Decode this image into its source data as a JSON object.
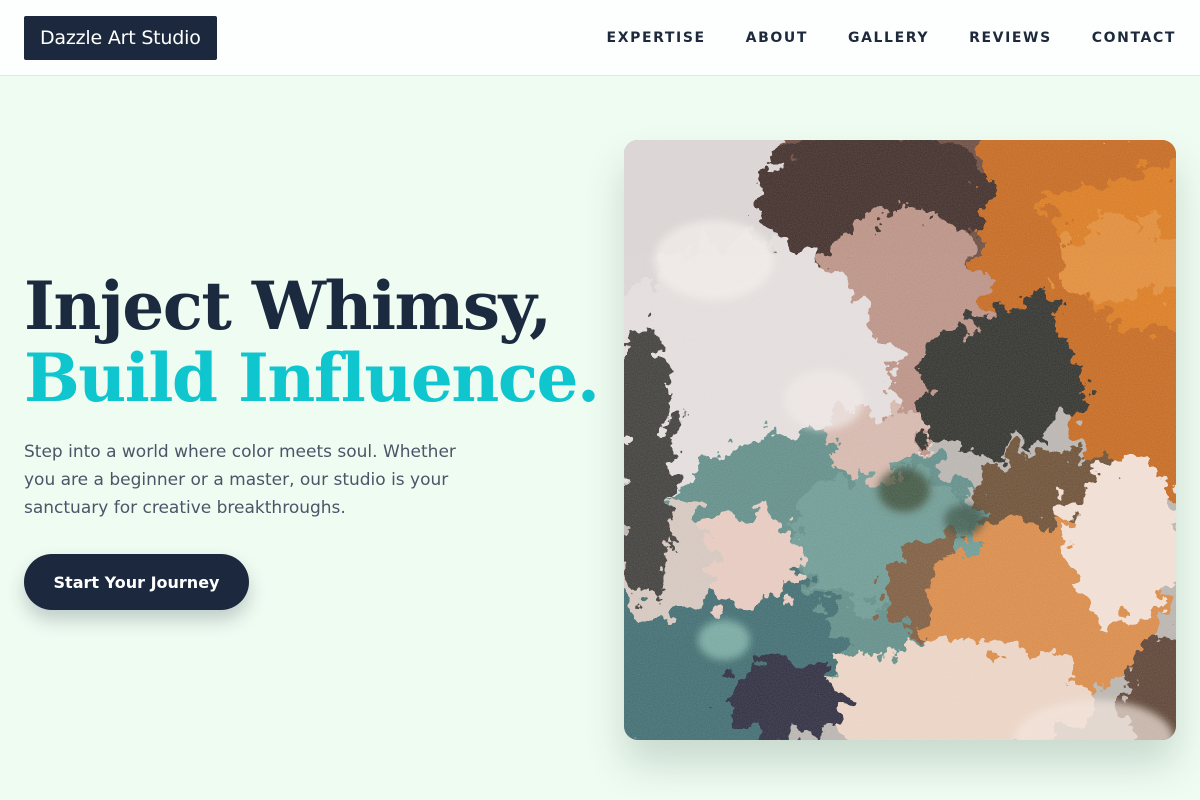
{
  "header": {
    "logo": "Dazzle Art Studio",
    "nav": [
      "EXPERTISE",
      "ABOUT",
      "GALLERY",
      "REVIEWS",
      "CONTACT"
    ]
  },
  "hero": {
    "title_line1": "Inject Whimsy,",
    "title_line2": "Build Influence.",
    "subtitle": "Step into a world where color meets soul. Whether you are a beginner or a master, our studio is your sanctuary for creative breakthroughs.",
    "cta_label": "Start Your Journey"
  },
  "colors": {
    "page_bg": "#effcf2",
    "brand_dark": "#1c283d",
    "accent": "#0fc6cf",
    "text_muted": "#4a5668"
  },
  "image": {
    "subject": "impasto-painting-texture"
  }
}
